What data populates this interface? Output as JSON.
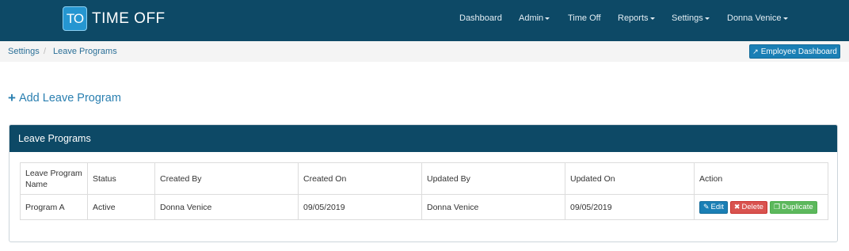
{
  "app": {
    "logo_badge": "TO",
    "logo_text": "TIME OFF"
  },
  "nav": {
    "dashboard": "Dashboard",
    "admin": "Admin",
    "time_off": "Time Off",
    "reports": "Reports",
    "settings": "Settings",
    "user": "Donna Venice"
  },
  "breadcrumb": {
    "settings": "Settings",
    "separator": "/",
    "current": "Leave Programs"
  },
  "employee_dashboard_button": "Employee Dashboard",
  "add_link": "Add Leave Program",
  "panel": {
    "title": "Leave Programs",
    "columns": [
      "Leave Program Name",
      "Status",
      "Created By",
      "Created On",
      "Updated By",
      "Updated On",
      "Action"
    ],
    "rows": [
      {
        "name": "Program A",
        "status": "Active",
        "created_by": "Donna Venice",
        "created_on": "09/05/2019",
        "updated_by": "Donna Venice",
        "updated_on": "09/05/2019"
      }
    ],
    "actions": {
      "edit": "Edit",
      "delete": "Delete",
      "duplicate": "Duplicate"
    }
  },
  "colors": {
    "navbar": "#0d4966",
    "accent": "#1a7fb5",
    "danger": "#d9534f",
    "success": "#5cb85c"
  }
}
